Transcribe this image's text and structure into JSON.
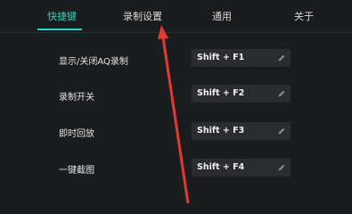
{
  "tabs": [
    {
      "label": "快捷键",
      "active": true
    },
    {
      "label": "录制设置",
      "active": false
    },
    {
      "label": "通用",
      "active": false
    },
    {
      "label": "关于",
      "active": false
    }
  ],
  "shortcuts": [
    {
      "label": "显示/关闭AQ录制",
      "key": "Shift + F1"
    },
    {
      "label": "录制开关",
      "key": "Shift + F2"
    },
    {
      "label": "即时回放",
      "key": "Shift + F3"
    },
    {
      "label": "一键截图",
      "key": "Shift + F4"
    }
  ],
  "colors": {
    "accent": "#2fd3b8",
    "background": "#1b1c1e",
    "field": "#2b2c2f",
    "annotation_arrow": "#e03a34"
  },
  "icons": {
    "edit": "pencil-icon"
  }
}
